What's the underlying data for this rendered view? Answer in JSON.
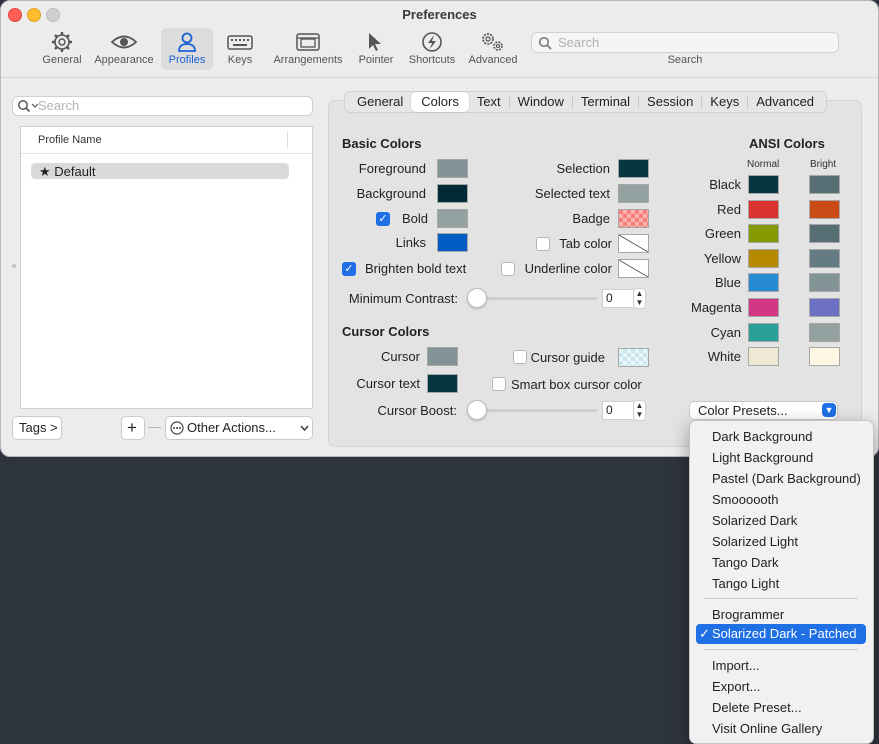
{
  "window": {
    "title": "Preferences"
  },
  "toolbar": {
    "items": [
      {
        "label": "General"
      },
      {
        "label": "Appearance"
      },
      {
        "label": "Profiles"
      },
      {
        "label": "Keys"
      },
      {
        "label": "Arrangements"
      },
      {
        "label": "Pointer"
      },
      {
        "label": "Shortcuts"
      },
      {
        "label": "Advanced"
      }
    ],
    "search_placeholder": "Search",
    "search_caption": "Search"
  },
  "profiles": {
    "search_placeholder": "Search",
    "column_header": "Profile Name",
    "items": [
      {
        "name": "Default",
        "icon": "star-icon"
      }
    ],
    "tags_button": "Tags >",
    "add_button": "+",
    "remove_button": "—",
    "other_actions": "Other Actions..."
  },
  "tabs": [
    "General",
    "Colors",
    "Text",
    "Window",
    "Terminal",
    "Session",
    "Keys",
    "Advanced"
  ],
  "active_tab": "Colors",
  "basic_colors": {
    "heading": "Basic Colors",
    "foreground": {
      "label": "Foreground",
      "color": "#839496"
    },
    "background": {
      "label": "Background",
      "color": "#002b36"
    },
    "bold": {
      "label": "Bold",
      "checked": true,
      "color": "#93a1a1"
    },
    "links": {
      "label": "Links",
      "color": "#005cc5"
    },
    "brighten_bold": {
      "label": "Brighten bold text",
      "checked": true
    },
    "selection": {
      "label": "Selection",
      "color": "#073642"
    },
    "selected_text": {
      "label": "Selected text",
      "color": "#93a1a1"
    },
    "badge": {
      "label": "Badge"
    },
    "tab_color": {
      "label": "Tab color",
      "checked": false
    },
    "underline_color": {
      "label": "Underline color",
      "checked": false
    },
    "min_contrast": {
      "label": "Minimum Contrast:",
      "value": "0"
    }
  },
  "cursor_colors": {
    "heading": "Cursor Colors",
    "cursor": {
      "label": "Cursor",
      "color": "#839496"
    },
    "cursor_text": {
      "label": "Cursor text",
      "color": "#073642"
    },
    "cursor_guide": {
      "label": "Cursor guide",
      "checked": false
    },
    "smart_box": {
      "label": "Smart box cursor color",
      "checked": false
    },
    "boost": {
      "label": "Cursor Boost:",
      "value": "0"
    }
  },
  "ansi": {
    "heading": "ANSI Colors",
    "normal_label": "Normal",
    "bright_label": "Bright",
    "rows": [
      {
        "name": "Black",
        "normal": "#073642",
        "bright": "#586e75"
      },
      {
        "name": "Red",
        "normal": "#dc322f",
        "bright": "#cb4b16"
      },
      {
        "name": "Green",
        "normal": "#859900",
        "bright": "#586e75"
      },
      {
        "name": "Yellow",
        "normal": "#b58900",
        "bright": "#657b83"
      },
      {
        "name": "Blue",
        "normal": "#268bd2",
        "bright": "#839496"
      },
      {
        "name": "Magenta",
        "normal": "#d33682",
        "bright": "#6c71c4"
      },
      {
        "name": "Cyan",
        "normal": "#2aa198",
        "bright": "#93a1a1"
      },
      {
        "name": "White",
        "normal": "#eee8d5",
        "bright": "#fdf6e3"
      }
    ]
  },
  "presets": {
    "button": "Color Presets...",
    "group1": [
      "Dark Background",
      "Light Background",
      "Pastel (Dark Background)",
      "Smoooooth",
      "Solarized Dark",
      "Solarized Light",
      "Tango Dark",
      "Tango Light"
    ],
    "group2": [
      "Brogrammer",
      "Solarized Dark - Patched"
    ],
    "selected": "Solarized Dark - Patched",
    "group3": [
      "Import...",
      "Export...",
      "Delete Preset...",
      "Visit Online Gallery"
    ]
  },
  "colors": {
    "accent": "#1f6fe5",
    "desktop": "#2e343d"
  }
}
